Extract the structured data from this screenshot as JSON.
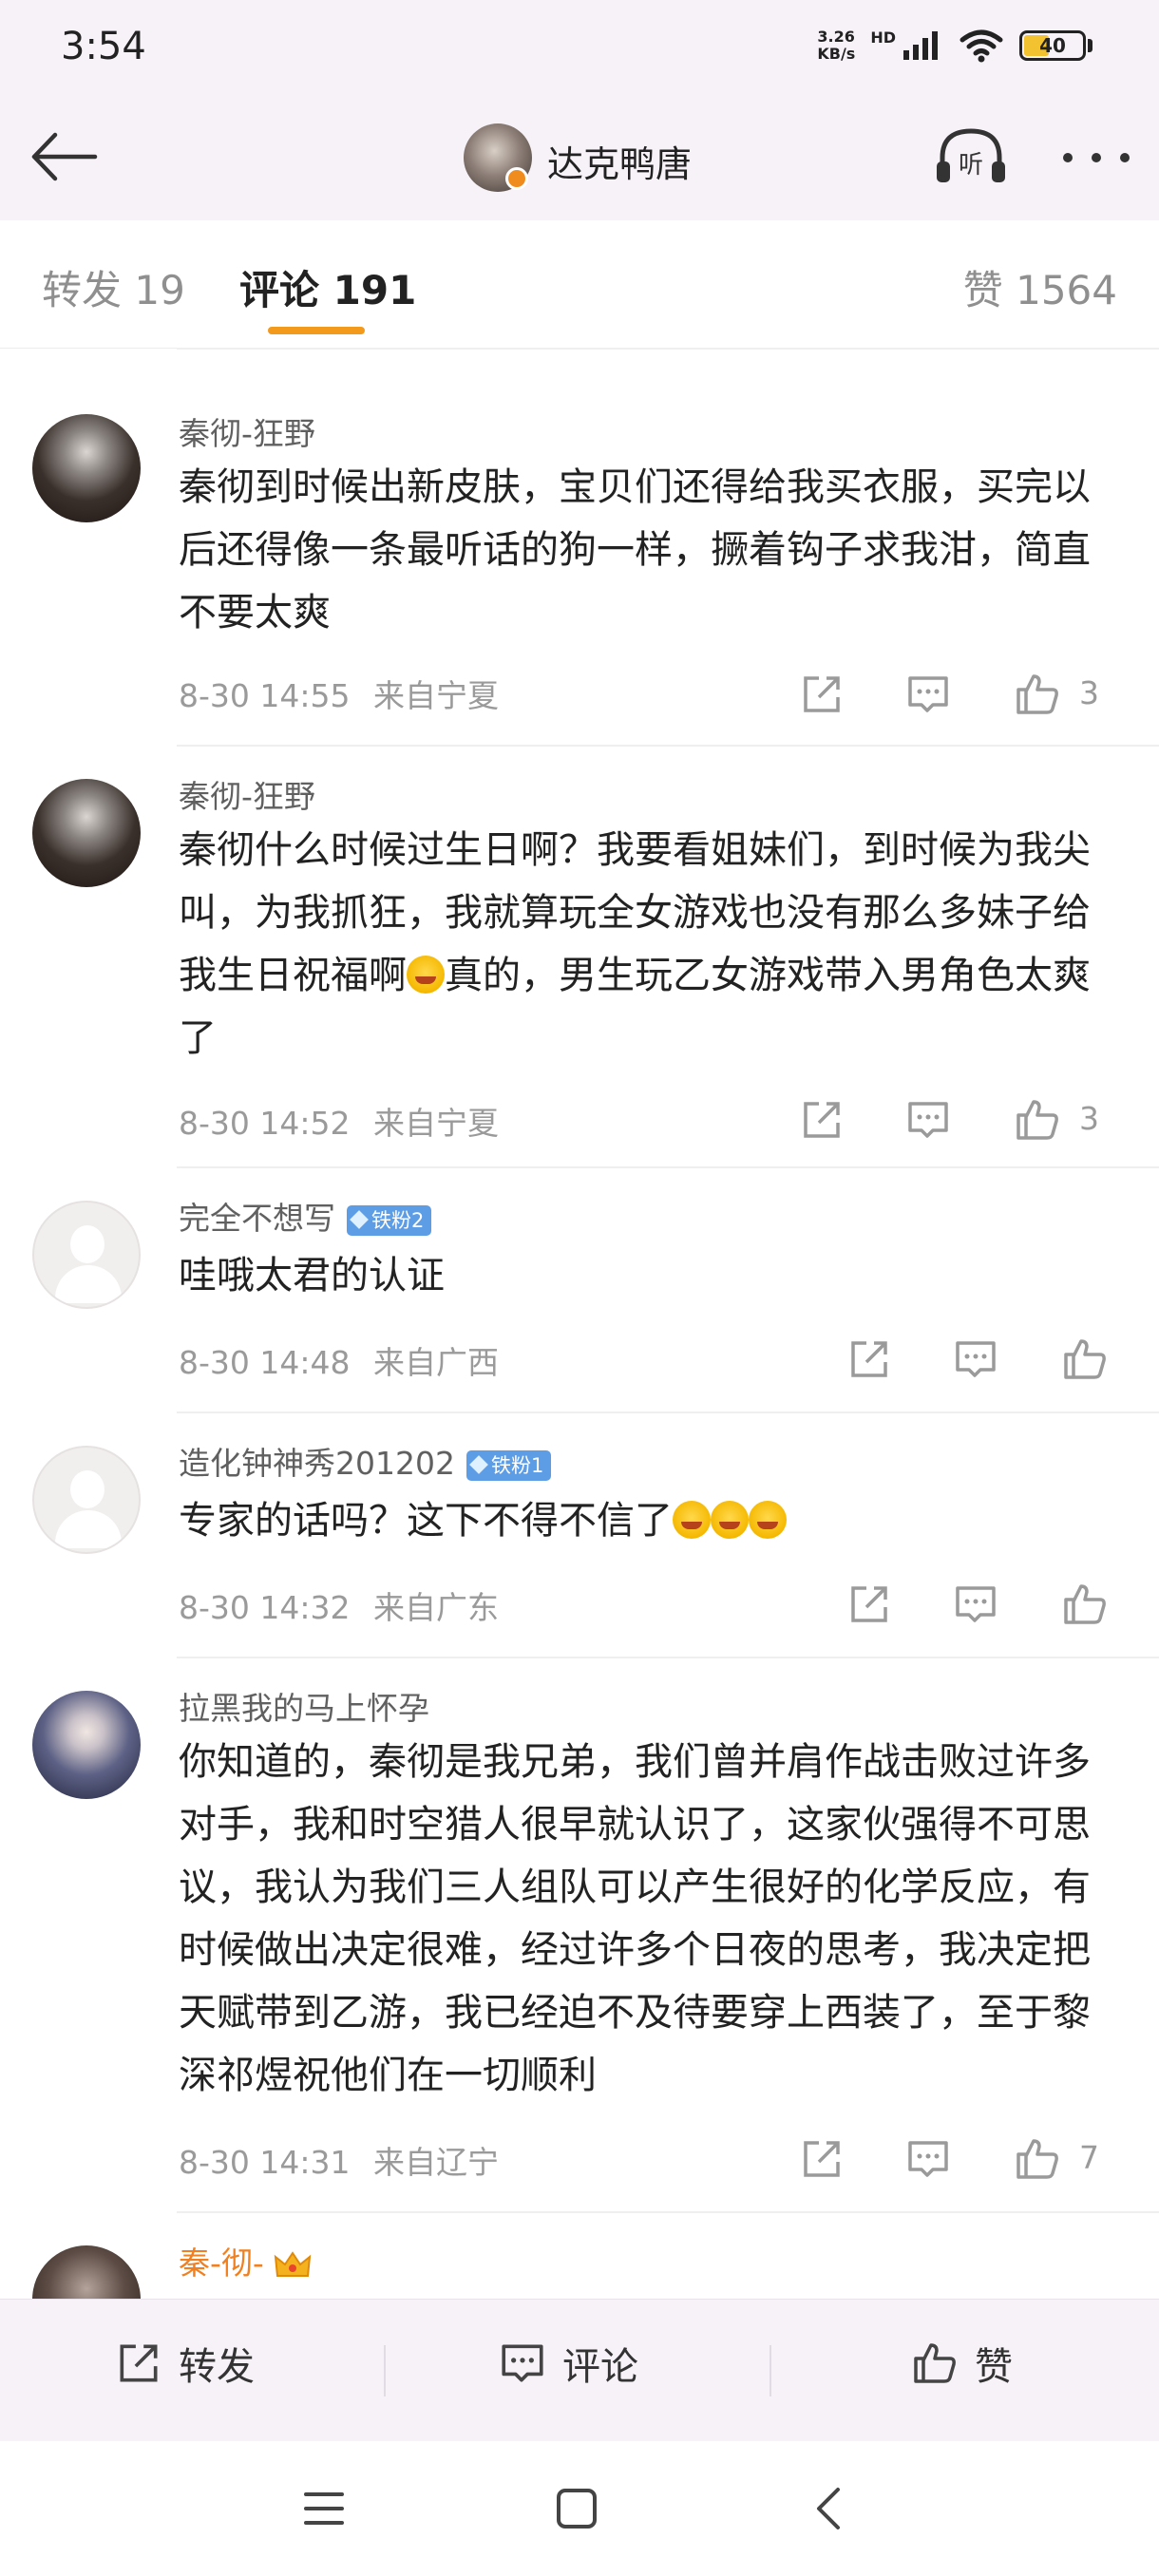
{
  "status": {
    "time": "3:54",
    "net_speed_value": "3.26",
    "net_speed_unit": "KB/s",
    "network": "HD",
    "battery": "40"
  },
  "header": {
    "title": "达克鸭唐",
    "back_icon": "back-arrow-icon",
    "listen_label": "听",
    "more_icon": "more-dots-icon"
  },
  "tabs": {
    "repost": "转发 19",
    "comment": "评论 191",
    "like": "赞 1564",
    "active": "comment",
    "accent_color": "#f39a1d"
  },
  "comments": [
    {
      "user": "秦彻-狂野",
      "text": "秦彻到时候出新皮肤，宝贝们还得给我买衣服，买完以后还得像一条最听话的狗一样，撅着钩子求我泔，简直不要太爽",
      "time": "8-30 14:55",
      "location": "来自宁夏",
      "likes": "3"
    },
    {
      "user": "秦彻-狂野",
      "text_a": "秦彻什么时候过生日啊？我要看姐妹们，到时候为我尖叫，为我抓狂，我就算玩全女游戏也没有那么多妹子给我生日祝福啊",
      "text_b": "真的，男生玩乙女游戏带入男角色太爽了",
      "emoji": "laugh-cry-emoji",
      "time": "8-30 14:52",
      "location": "来自宁夏",
      "likes": "3"
    },
    {
      "user": "完全不想写",
      "badge": "铁粉2",
      "text": "哇哦太君的认证",
      "time": "8-30 14:48",
      "location": "来自广西",
      "likes": ""
    },
    {
      "user": "造化钟神秀201202",
      "badge": "铁粉1",
      "text": "专家的话吗？这下不得不信了",
      "emoji": "crying-emoji",
      "time": "8-30 14:32",
      "location": "来自广东",
      "likes": ""
    },
    {
      "user": "拉黑我的马上怀孕",
      "text": "你知道的，秦彻是我兄弟，我们曾并肩作战击败过许多对手，我和时空猎人很早就认识了，这家伙强得不可思议，我认为我们三人组队可以产生很好的化学反应，有时候做出决定很难，经过许多个日夜的思考，我决定把天赋带到乙游，我已经迫不及待要穿上西装了，至于黎深祁煜祝他们在一切顺利",
      "time": "8-30 14:31",
      "location": "来自辽宁",
      "likes": "7"
    },
    {
      "user": "秦-彻-",
      "crown_icon": "crown-icon"
    }
  ],
  "bottom_bar": {
    "repost": "转发",
    "comment": "评论",
    "like": "赞"
  },
  "nav": {
    "menu_icon": "menu-icon",
    "home_icon": "home-square-icon",
    "back_icon": "nav-back-icon"
  }
}
